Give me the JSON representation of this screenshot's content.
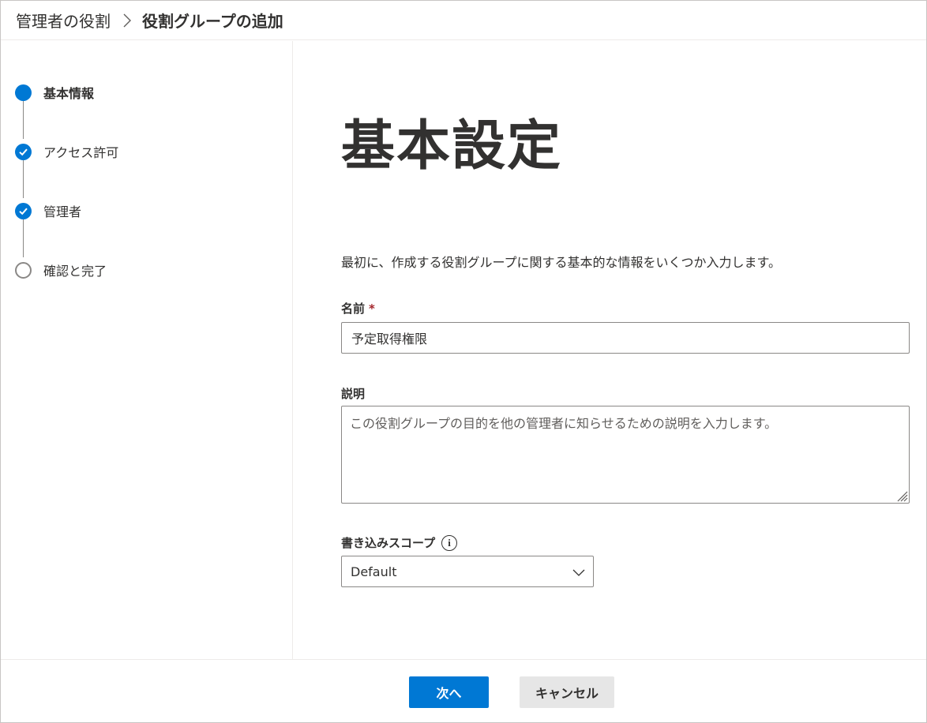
{
  "breadcrumb": {
    "parent": "管理者の役割",
    "current": "役割グループの追加"
  },
  "steps": [
    {
      "label": "基本情報",
      "state": "current"
    },
    {
      "label": "アクセス許可",
      "state": "done"
    },
    {
      "label": "管理者",
      "state": "done"
    },
    {
      "label": "確認と完了",
      "state": "pending"
    }
  ],
  "form": {
    "title": "基本設定",
    "intro": "最初に、作成する役割グループに関する基本的な情報をいくつか入力します。",
    "name": {
      "label": "名前",
      "required_mark": "*",
      "value": "予定取得権限"
    },
    "description": {
      "label": "説明",
      "placeholder": "この役割グループの目的を他の管理者に知らせるための説明を入力します。"
    },
    "write_scope": {
      "label": "書き込みスコープ",
      "info_icon": "info-icon",
      "selected": "Default"
    }
  },
  "footer": {
    "next_label": "次へ",
    "cancel_label": "キャンセル"
  },
  "colors": {
    "accent": "#0078d4",
    "required": "#a4262c",
    "secondary_button": "#e6e6e6"
  }
}
